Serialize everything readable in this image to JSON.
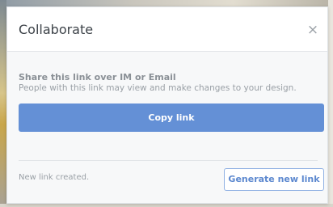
{
  "dialog": {
    "title": "Collaborate",
    "close_icon": "close-icon",
    "close_glyph": "×"
  },
  "share": {
    "heading": "Share this link over IM or Email",
    "description": "People with this link may view and make changes to your design.",
    "copy_button_label": "Copy link"
  },
  "footer": {
    "status": "New link created.",
    "generate_button_label": "Generate new link"
  },
  "colors": {
    "primary_button": "#6490d6",
    "outline_button_border": "#8fb0e3",
    "outline_button_text": "#5c88cf"
  }
}
